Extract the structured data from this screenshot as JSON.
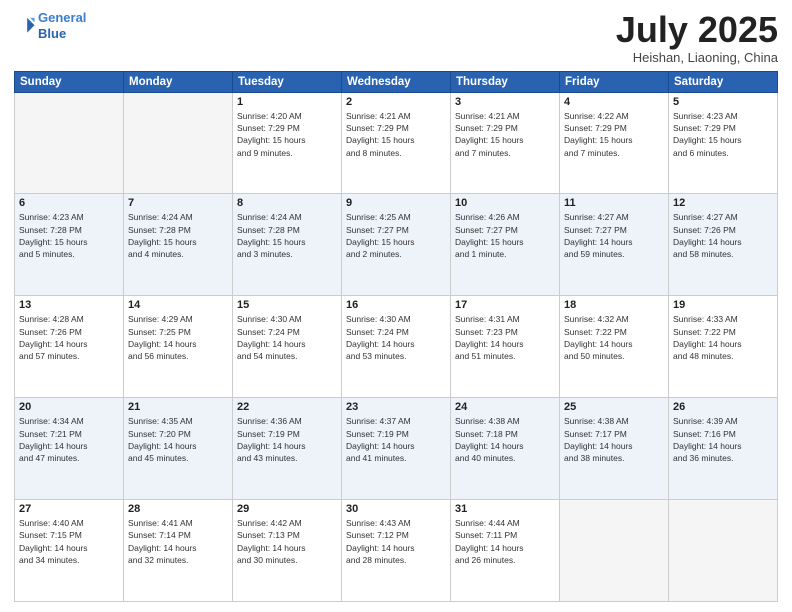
{
  "header": {
    "logo_line1": "General",
    "logo_line2": "Blue",
    "month": "July 2025",
    "location": "Heishan, Liaoning, China"
  },
  "weekdays": [
    "Sunday",
    "Monday",
    "Tuesday",
    "Wednesday",
    "Thursday",
    "Friday",
    "Saturday"
  ],
  "rows": [
    [
      {
        "day": "",
        "info": "",
        "empty": true
      },
      {
        "day": "",
        "info": "",
        "empty": true
      },
      {
        "day": "1",
        "info": "Sunrise: 4:20 AM\nSunset: 7:29 PM\nDaylight: 15 hours\nand 9 minutes.",
        "empty": false
      },
      {
        "day": "2",
        "info": "Sunrise: 4:21 AM\nSunset: 7:29 PM\nDaylight: 15 hours\nand 8 minutes.",
        "empty": false
      },
      {
        "day": "3",
        "info": "Sunrise: 4:21 AM\nSunset: 7:29 PM\nDaylight: 15 hours\nand 7 minutes.",
        "empty": false
      },
      {
        "day": "4",
        "info": "Sunrise: 4:22 AM\nSunset: 7:29 PM\nDaylight: 15 hours\nand 7 minutes.",
        "empty": false
      },
      {
        "day": "5",
        "info": "Sunrise: 4:23 AM\nSunset: 7:29 PM\nDaylight: 15 hours\nand 6 minutes.",
        "empty": false
      }
    ],
    [
      {
        "day": "6",
        "info": "Sunrise: 4:23 AM\nSunset: 7:28 PM\nDaylight: 15 hours\nand 5 minutes.",
        "empty": false
      },
      {
        "day": "7",
        "info": "Sunrise: 4:24 AM\nSunset: 7:28 PM\nDaylight: 15 hours\nand 4 minutes.",
        "empty": false
      },
      {
        "day": "8",
        "info": "Sunrise: 4:24 AM\nSunset: 7:28 PM\nDaylight: 15 hours\nand 3 minutes.",
        "empty": false
      },
      {
        "day": "9",
        "info": "Sunrise: 4:25 AM\nSunset: 7:27 PM\nDaylight: 15 hours\nand 2 minutes.",
        "empty": false
      },
      {
        "day": "10",
        "info": "Sunrise: 4:26 AM\nSunset: 7:27 PM\nDaylight: 15 hours\nand 1 minute.",
        "empty": false
      },
      {
        "day": "11",
        "info": "Sunrise: 4:27 AM\nSunset: 7:27 PM\nDaylight: 14 hours\nand 59 minutes.",
        "empty": false
      },
      {
        "day": "12",
        "info": "Sunrise: 4:27 AM\nSunset: 7:26 PM\nDaylight: 14 hours\nand 58 minutes.",
        "empty": false
      }
    ],
    [
      {
        "day": "13",
        "info": "Sunrise: 4:28 AM\nSunset: 7:26 PM\nDaylight: 14 hours\nand 57 minutes.",
        "empty": false
      },
      {
        "day": "14",
        "info": "Sunrise: 4:29 AM\nSunset: 7:25 PM\nDaylight: 14 hours\nand 56 minutes.",
        "empty": false
      },
      {
        "day": "15",
        "info": "Sunrise: 4:30 AM\nSunset: 7:24 PM\nDaylight: 14 hours\nand 54 minutes.",
        "empty": false
      },
      {
        "day": "16",
        "info": "Sunrise: 4:30 AM\nSunset: 7:24 PM\nDaylight: 14 hours\nand 53 minutes.",
        "empty": false
      },
      {
        "day": "17",
        "info": "Sunrise: 4:31 AM\nSunset: 7:23 PM\nDaylight: 14 hours\nand 51 minutes.",
        "empty": false
      },
      {
        "day": "18",
        "info": "Sunrise: 4:32 AM\nSunset: 7:22 PM\nDaylight: 14 hours\nand 50 minutes.",
        "empty": false
      },
      {
        "day": "19",
        "info": "Sunrise: 4:33 AM\nSunset: 7:22 PM\nDaylight: 14 hours\nand 48 minutes.",
        "empty": false
      }
    ],
    [
      {
        "day": "20",
        "info": "Sunrise: 4:34 AM\nSunset: 7:21 PM\nDaylight: 14 hours\nand 47 minutes.",
        "empty": false
      },
      {
        "day": "21",
        "info": "Sunrise: 4:35 AM\nSunset: 7:20 PM\nDaylight: 14 hours\nand 45 minutes.",
        "empty": false
      },
      {
        "day": "22",
        "info": "Sunrise: 4:36 AM\nSunset: 7:19 PM\nDaylight: 14 hours\nand 43 minutes.",
        "empty": false
      },
      {
        "day": "23",
        "info": "Sunrise: 4:37 AM\nSunset: 7:19 PM\nDaylight: 14 hours\nand 41 minutes.",
        "empty": false
      },
      {
        "day": "24",
        "info": "Sunrise: 4:38 AM\nSunset: 7:18 PM\nDaylight: 14 hours\nand 40 minutes.",
        "empty": false
      },
      {
        "day": "25",
        "info": "Sunrise: 4:38 AM\nSunset: 7:17 PM\nDaylight: 14 hours\nand 38 minutes.",
        "empty": false
      },
      {
        "day": "26",
        "info": "Sunrise: 4:39 AM\nSunset: 7:16 PM\nDaylight: 14 hours\nand 36 minutes.",
        "empty": false
      }
    ],
    [
      {
        "day": "27",
        "info": "Sunrise: 4:40 AM\nSunset: 7:15 PM\nDaylight: 14 hours\nand 34 minutes.",
        "empty": false
      },
      {
        "day": "28",
        "info": "Sunrise: 4:41 AM\nSunset: 7:14 PM\nDaylight: 14 hours\nand 32 minutes.",
        "empty": false
      },
      {
        "day": "29",
        "info": "Sunrise: 4:42 AM\nSunset: 7:13 PM\nDaylight: 14 hours\nand 30 minutes.",
        "empty": false
      },
      {
        "day": "30",
        "info": "Sunrise: 4:43 AM\nSunset: 7:12 PM\nDaylight: 14 hours\nand 28 minutes.",
        "empty": false
      },
      {
        "day": "31",
        "info": "Sunrise: 4:44 AM\nSunset: 7:11 PM\nDaylight: 14 hours\nand 26 minutes.",
        "empty": false
      },
      {
        "day": "",
        "info": "",
        "empty": true
      },
      {
        "day": "",
        "info": "",
        "empty": true
      }
    ]
  ]
}
